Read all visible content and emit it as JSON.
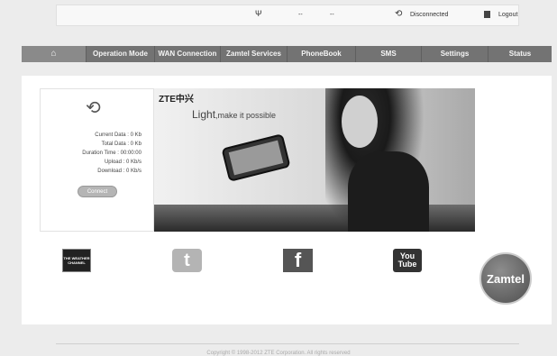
{
  "status_bar": {
    "signal_icon": "signal-antenna-icon",
    "network_type": "--",
    "roaming": "--",
    "connection_status": "Disconnected",
    "logout_label": "Logout"
  },
  "nav": {
    "home_icon": "home-icon",
    "items": [
      {
        "label": "Operation Mode"
      },
      {
        "label": "WAN Connection"
      },
      {
        "label": "Zamtel Services"
      },
      {
        "label": "PhoneBook"
      },
      {
        "label": "SMS"
      },
      {
        "label": "Settings"
      },
      {
        "label": "Status"
      }
    ]
  },
  "connection_panel": {
    "current_data": "Current Data : 0 Kb",
    "total_data": "Total Data : 0 Kb",
    "duration": "Duration Time : 00:00:00",
    "upload": "Upload : 0 Kb/s",
    "download": "Download : 0 Kb/s",
    "connect_label": "Connect"
  },
  "banner": {
    "brand": "ZTE中兴",
    "tagline_bold": "Light",
    "tagline_rest": ",make it possible"
  },
  "links": {
    "weather": "THE WEATHER CHANNEL",
    "twitter": "t",
    "facebook": "f",
    "youtube_1": "You",
    "youtube_2": "Tube",
    "zamtel": "Zamtel"
  },
  "footer": {
    "copyright": "Copyright © 1998-2012 ZTE Corporation. All rights reserved"
  }
}
